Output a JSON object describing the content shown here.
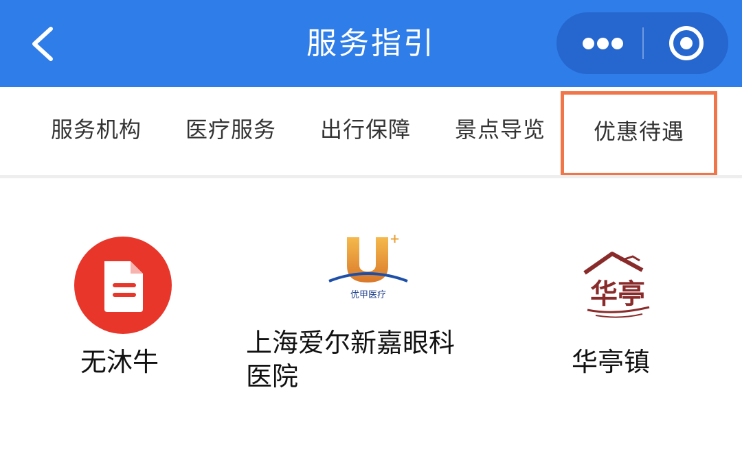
{
  "header": {
    "title": "服务指引"
  },
  "tabs": [
    {
      "label": "服务机构"
    },
    {
      "label": "医疗服务"
    },
    {
      "label": "出行保障"
    },
    {
      "label": "景点导览"
    },
    {
      "label": "优惠待遇"
    }
  ],
  "services": [
    {
      "label": "无沐牛",
      "icon": "document-icon"
    },
    {
      "label_line1": "上海爱尔新嘉眼科",
      "label_line2": "医院",
      "logo_text": "优甲医疗"
    },
    {
      "label": "华亭镇",
      "logo_text": "华亭"
    }
  ],
  "colors": {
    "header_blue": "#2f7de8",
    "capsule_blue": "#2566cf",
    "highlight_border": "#f0764a",
    "doc_icon_red": "#e8362a",
    "logo_gold": "#e8a33a",
    "logo_maroon": "#8a2b2b"
  }
}
